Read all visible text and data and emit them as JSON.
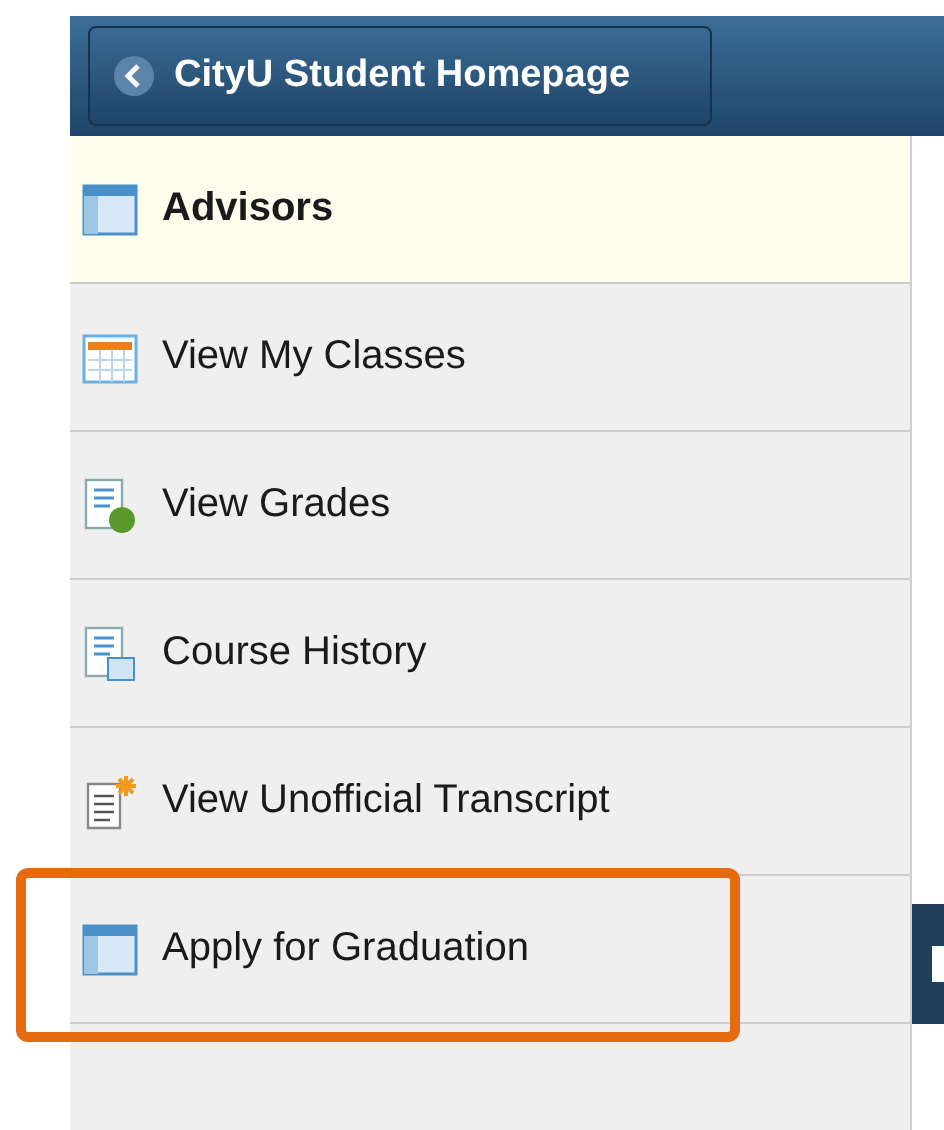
{
  "header": {
    "back_button": {
      "label": "CityU Student Homepage"
    }
  },
  "menu": {
    "items": [
      {
        "label": "Advisors",
        "kind": "window",
        "selected": true
      },
      {
        "label": "View My Classes",
        "kind": "calendar",
        "selected": false
      },
      {
        "label": "View Grades",
        "kind": "grades",
        "selected": false
      },
      {
        "label": "Course History",
        "kind": "history",
        "selected": false
      },
      {
        "label": "View Unofficial Transcript",
        "kind": "transcript",
        "selected": false
      },
      {
        "label": "Apply for Graduation",
        "kind": "window",
        "selected": false,
        "highlighted": true
      }
    ]
  }
}
